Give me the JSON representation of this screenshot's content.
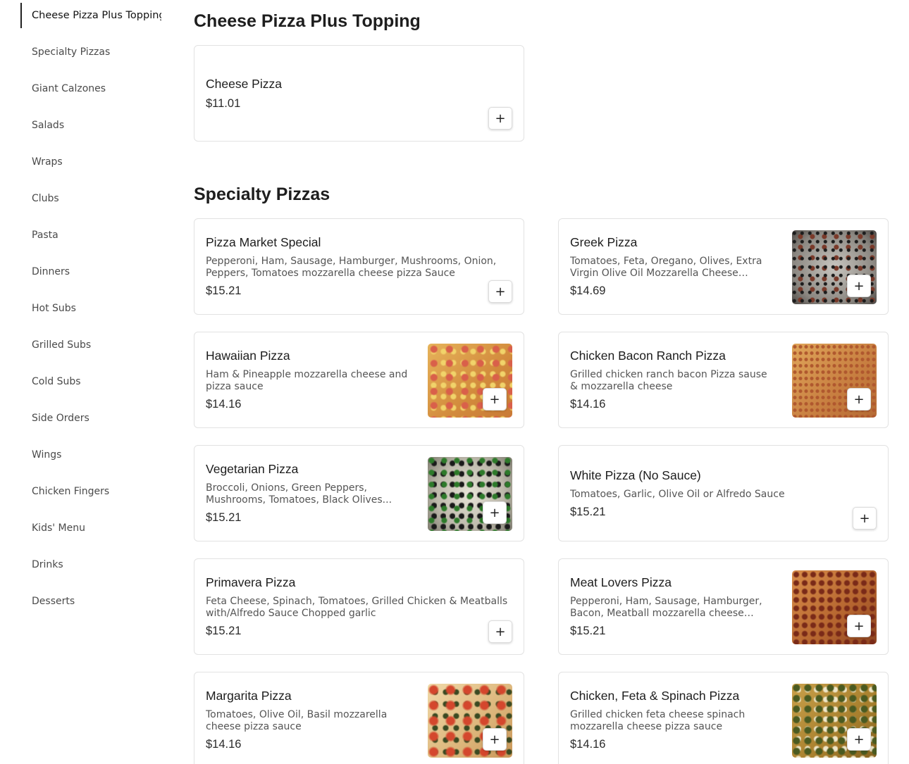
{
  "sidebar": {
    "items": [
      {
        "label": "Cheese Pizza Plus Topping"
      },
      {
        "label": "Specialty Pizzas"
      },
      {
        "label": "Giant Calzones"
      },
      {
        "label": "Salads"
      },
      {
        "label": "Wraps"
      },
      {
        "label": "Clubs"
      },
      {
        "label": "Pasta"
      },
      {
        "label": "Dinners"
      },
      {
        "label": "Hot Subs"
      },
      {
        "label": "Grilled Subs"
      },
      {
        "label": "Cold Subs"
      },
      {
        "label": "Side Orders"
      },
      {
        "label": "Wings"
      },
      {
        "label": "Chicken Fingers"
      },
      {
        "label": "Kids' Menu"
      },
      {
        "label": "Drinks"
      },
      {
        "label": "Desserts"
      }
    ],
    "active_index": 0
  },
  "sections": [
    {
      "title": "Cheese Pizza Plus Topping",
      "items": [
        {
          "name": "Cheese Pizza",
          "desc": "",
          "price": "$11.01",
          "image": ""
        }
      ]
    },
    {
      "title": "Specialty Pizzas",
      "items": [
        {
          "name": "Pizza Market Special",
          "desc": "Pepperoni, Ham, Sausage, Hamburger, Mushrooms, Onion, Peppers, Tomatoes mozzarella cheese pizza Sauce",
          "price": "$15.21",
          "image": ""
        },
        {
          "name": "Greek Pizza",
          "desc": "Tomatoes, Feta, Oregano, Olives, Extra Virgin Olive Oil Mozzarella Cheese pizza...",
          "price": "$14.69",
          "image": "greek-pizza-photo"
        },
        {
          "name": "Hawaiian Pizza",
          "desc": "Ham & Pineapple mozzarella cheese and pizza sauce",
          "price": "$14.16",
          "image": "hawaiian-pizza-photo"
        },
        {
          "name": "Chicken Bacon Ranch Pizza",
          "desc": "Grilled chicken ranch bacon Pizza sause & mozzarella cheese",
          "price": "$14.16",
          "image": "chicken-bacon-ranch-pizza-photo"
        },
        {
          "name": "Vegetarian Pizza",
          "desc": "Broccoli, Onions, Green Peppers, Mushrooms, Tomatoes, Black Olives...",
          "price": "$15.21",
          "image": "vegetarian-pizza-photo"
        },
        {
          "name": "White Pizza (No Sauce)",
          "desc": "Tomatoes, Garlic, Olive Oil or Alfredo Sauce",
          "price": "$15.21",
          "image": ""
        },
        {
          "name": "Primavera Pizza",
          "desc": "Feta Cheese, Spinach, Tomatoes, Grilled Chicken & Meatballs with/Alfredo Sauce Chopped garlic",
          "price": "$15.21",
          "image": ""
        },
        {
          "name": "Meat Lovers Pizza",
          "desc": "Pepperoni, Ham, Sausage, Hamburger, Bacon, Meatball mozzarella cheese pizza...",
          "price": "$15.21",
          "image": "meat-lovers-pizza-photo"
        },
        {
          "name": "Margarita Pizza",
          "desc": "Tomatoes, Olive Oil, Basil mozzarella cheese pizza sauce",
          "price": "$14.16",
          "image": "margarita-pizza-photo"
        },
        {
          "name": "Chicken, Feta & Spinach Pizza",
          "desc": "Grilled chicken feta cheese spinach mozzarella cheese pizza sauce",
          "price": "$14.16",
          "image": "chicken-feta-spinach-pizza-photo"
        }
      ]
    }
  ],
  "add_button_label": "+"
}
